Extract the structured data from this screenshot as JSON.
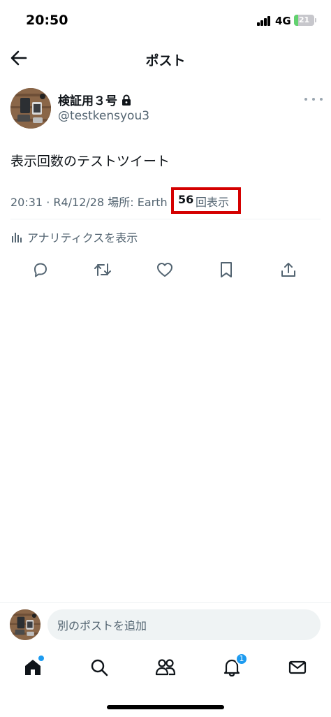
{
  "status_bar": {
    "time": "20:50",
    "network": "4G",
    "battery_level": "21",
    "battery_fraction": 0.21
  },
  "header": {
    "title": "ポスト"
  },
  "post": {
    "author_name": "検証用３号",
    "author_handle": "@testkensyou3",
    "text": "表示回数のテストツイート",
    "meta": "20:31 · R4/12/28 場所: Earth",
    "views_count": "56",
    "views_label": "回表示",
    "highlight_color": "#d40000"
  },
  "analytics": {
    "label": "アナリティクスを表示"
  },
  "composer": {
    "placeholder": "別のポストを追加"
  },
  "tab_bar": {
    "notification_badge": "1",
    "accent": "#1d9bf0"
  }
}
